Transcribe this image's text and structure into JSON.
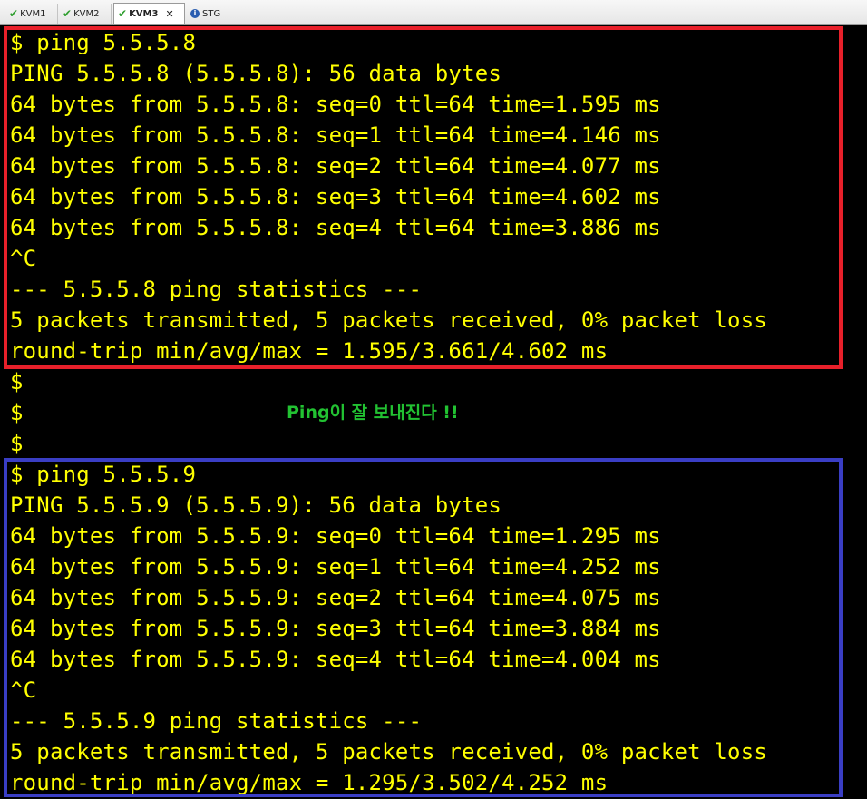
{
  "tabs": [
    {
      "label": "KVM1",
      "icon": "check-icon"
    },
    {
      "label": "KVM2",
      "icon": "check-icon"
    },
    {
      "label": "KVM3",
      "icon": "check-icon",
      "active": true
    },
    {
      "label": "STG",
      "icon": "info-icon"
    }
  ],
  "terminal": {
    "block1": [
      "$ ping 5.5.5.8",
      "PING 5.5.5.8 (5.5.5.8): 56 data bytes",
      "64 bytes from 5.5.5.8: seq=0 ttl=64 time=1.595 ms",
      "64 bytes from 5.5.5.8: seq=1 ttl=64 time=4.146 ms",
      "64 bytes from 5.5.5.8: seq=2 ttl=64 time=4.077 ms",
      "64 bytes from 5.5.5.8: seq=3 ttl=64 time=4.602 ms",
      "64 bytes from 5.5.5.8: seq=4 ttl=64 time=3.886 ms",
      "^C",
      "--- 5.5.5.8 ping statistics ---",
      "5 packets transmitted, 5 packets received, 0% packet loss",
      "round-trip min/avg/max = 1.595/3.661/4.602 ms"
    ],
    "prompts": [
      "$",
      "$",
      "$"
    ],
    "note": "Ping이 잘 보내진다 !!",
    "block2": [
      "$ ping 5.5.5.9",
      "PING 5.5.5.9 (5.5.5.9): 56 data bytes",
      "64 bytes from 5.5.5.9: seq=0 ttl=64 time=1.295 ms",
      "64 bytes from 5.5.5.9: seq=1 ttl=64 time=4.252 ms",
      "64 bytes from 5.5.5.9: seq=2 ttl=64 time=4.075 ms",
      "64 bytes from 5.5.5.9: seq=3 ttl=64 time=3.884 ms",
      "64 bytes from 5.5.5.9: seq=4 ttl=64 time=4.004 ms",
      "^C",
      "--- 5.5.5.9 ping statistics ---",
      "5 packets transmitted, 5 packets received, 0% packet loss",
      "round-trip min/avg/max = 1.295/3.502/4.252 ms"
    ]
  },
  "colors": {
    "text": "#ffff00",
    "note": "#22c232",
    "box1": "#e8202a",
    "box2": "#3a3ec4",
    "background": "#000000"
  }
}
